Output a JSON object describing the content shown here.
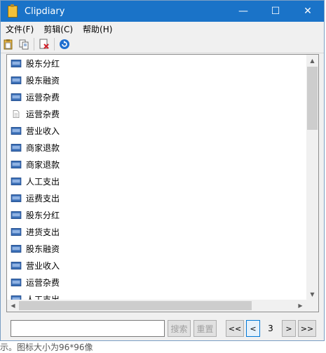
{
  "window": {
    "title": "Clipdiary",
    "minimize_label": "—",
    "maximize_label": "☐",
    "close_label": "✕"
  },
  "menu": [
    {
      "label": "文件(F)"
    },
    {
      "label": "剪辑(C)"
    },
    {
      "label": "帮助(H)"
    }
  ],
  "toolbar": {
    "icons": [
      "paste-icon",
      "copy-icon",
      "delete-icon",
      "refresh-icon"
    ]
  },
  "clips": [
    {
      "label": "股东分红",
      "type": "html"
    },
    {
      "label": "股东融资",
      "type": "html"
    },
    {
      "label": "运营杂费",
      "type": "html"
    },
    {
      "label": "运营杂费",
      "type": "text"
    },
    {
      "label": "营业收入",
      "type": "html"
    },
    {
      "label": "商家退款",
      "type": "html"
    },
    {
      "label": "商家退款",
      "type": "html"
    },
    {
      "label": "人工支出",
      "type": "html"
    },
    {
      "label": "运费支出",
      "type": "html"
    },
    {
      "label": "股东分红",
      "type": "html"
    },
    {
      "label": "进货支出",
      "type": "html"
    },
    {
      "label": "股东融资",
      "type": "html"
    },
    {
      "label": "营业收入",
      "type": "html"
    },
    {
      "label": "运营杂费",
      "type": "html"
    },
    {
      "label": "人工支出",
      "type": "html"
    }
  ],
  "search": {
    "value": "",
    "placeholder": "",
    "search_label": "搜索",
    "reset_label": "重置"
  },
  "pager": {
    "first_label": "<<",
    "prev_label": "<",
    "page": "3",
    "next_label": ">",
    "last_label": ">>"
  },
  "background_text": "示。图标大小为96*96像",
  "colors": {
    "titlebar": "#1a73c8",
    "html_icon": "#3b6fb6",
    "window_bg": "#f0f0f0"
  }
}
